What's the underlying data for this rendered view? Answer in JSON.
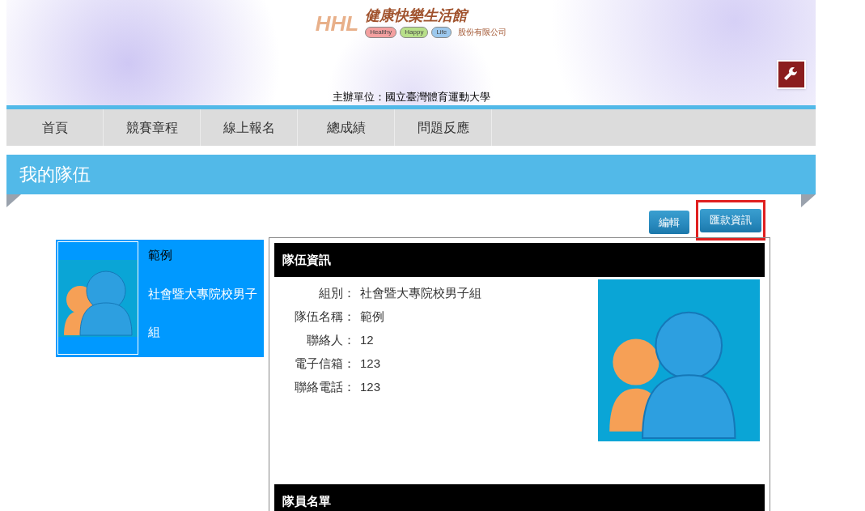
{
  "header": {
    "logo_mark": "HHL",
    "logo_title": "健康快樂生活館",
    "logo_tags": [
      {
        "label": "Healthy",
        "color": "#f4a0a0"
      },
      {
        "label": "Happy",
        "color": "#b8e08a"
      },
      {
        "label": "Life",
        "color": "#9cc8ee"
      }
    ],
    "company": "股份有限公司",
    "organizer": "主辦單位：國立臺灣體育運動大學"
  },
  "nav": [
    {
      "label": "首頁"
    },
    {
      "label": "競賽章程"
    },
    {
      "label": "線上報名"
    },
    {
      "label": "總成績"
    },
    {
      "label": "問題反應"
    }
  ],
  "page_title": "我的隊伍",
  "actions": [
    {
      "label": "編輯",
      "highlighted": false
    },
    {
      "label": "匯款資訊",
      "highlighted": true
    }
  ],
  "team_card": {
    "name": "範例",
    "group": "社會暨大專院校男子組",
    "selected": true
  },
  "team_info": {
    "heading": "隊伍資訊",
    "fields": [
      {
        "label": "組別：",
        "value": "社會暨大專院校男子組"
      },
      {
        "label": "隊伍名稱：",
        "value": "範例"
      },
      {
        "label": "聯絡人：",
        "value": "12"
      },
      {
        "label": "電子信箱：",
        "value": "123"
      },
      {
        "label": "聯絡電話：",
        "value": "123"
      }
    ]
  },
  "members": {
    "heading": "隊員名單"
  }
}
